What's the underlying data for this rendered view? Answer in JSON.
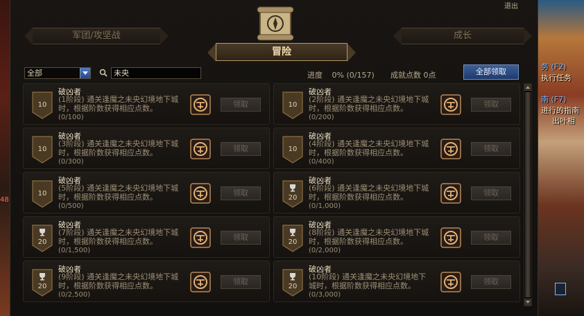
{
  "window": {
    "exit_label": "退出"
  },
  "tabs": {
    "legion": "军团/攻坚战",
    "adventure": "冒险",
    "growth": "成长"
  },
  "toolbar": {
    "filter_value": "全部",
    "search_value": "未央",
    "progress_label": "进度",
    "progress_value": "0% (0/157)",
    "points_label": "成就点数",
    "points_value": "0点",
    "claim_all_label": "全部领取"
  },
  "achievements": [
    {
      "title": "破凶者",
      "desc": "(1阶段) 通关逢魔之未央幻境地下城时，根据阶数获得相应点数。",
      "progress": "(0/100)",
      "points": "10",
      "badge_type": "plain"
    },
    {
      "title": "破凶者",
      "desc": "(2阶段) 通关逢魔之未央幻境地下城时，根据阶数获得相应点数。",
      "progress": "(0/200)",
      "points": "10",
      "badge_type": "plain"
    },
    {
      "title": "破凶者",
      "desc": "(3阶段) 通关逢魔之未央幻境地下城时，根据阶数获得相应点数。",
      "progress": "(0/300)",
      "points": "10",
      "badge_type": "plain"
    },
    {
      "title": "破凶者",
      "desc": "(4阶段) 通关逢魔之未央幻境地下城时，根据阶数获得相应点数。",
      "progress": "(0/400)",
      "points": "10",
      "badge_type": "plain"
    },
    {
      "title": "破凶者",
      "desc": "(5阶段) 通关逢魔之未央幻境地下城时，根据阶数获得相应点数。",
      "progress": "(0/500)",
      "points": "10",
      "badge_type": "plain"
    },
    {
      "title": "破凶者",
      "desc": "(6阶段) 通关逢魔之未央幻境地下城时，根据阶数获得相应点数。",
      "progress": "(0/1,000)",
      "points": "20",
      "badge_type": "trophy"
    },
    {
      "title": "破凶者",
      "desc": "(7阶段) 通关逢魔之未央幻境地下城时，根据阶数获得相应点数。",
      "progress": "(0/1,500)",
      "points": "20",
      "badge_type": "trophy"
    },
    {
      "title": "破凶者",
      "desc": "(8阶段) 通关逢魔之未央幻境地下城时，根据阶数获得相应点数。",
      "progress": "(0/2,000)",
      "points": "20",
      "badge_type": "trophy"
    },
    {
      "title": "破凶者",
      "desc": "(9阶段) 通关逢魔之未央幻境地下城时，根据阶数获得相应点数。",
      "progress": "(0/2,500)",
      "points": "20",
      "badge_type": "trophy"
    },
    {
      "title": "破凶者",
      "desc": "(10阶段) 通关逢魔之未央幻境地下城时，根据阶数获得相应点数。",
      "progress": "(0/3,000)",
      "points": "20",
      "badge_type": "trophy"
    }
  ],
  "claim_label": "领取",
  "side": {
    "quest_hotkey": "务 (F2)",
    "quest_text": "执行任务",
    "guide_hotkey": "南 (F7)",
    "guide_text": "进行的指南",
    "guide_sub": "出叶相",
    "left_number": "48"
  },
  "icons": [
    "scroll-emblem-icon",
    "search-icon",
    "dropdown-arrow-icon",
    "shield-badge-icon",
    "trophy-icon",
    "achievement-emblem-icon",
    "scroll-up-icon",
    "scroll-down-icon"
  ],
  "colors": {
    "gold": "#b89a62",
    "blue_button": "#2d4f86",
    "panel": "#15120f"
  }
}
